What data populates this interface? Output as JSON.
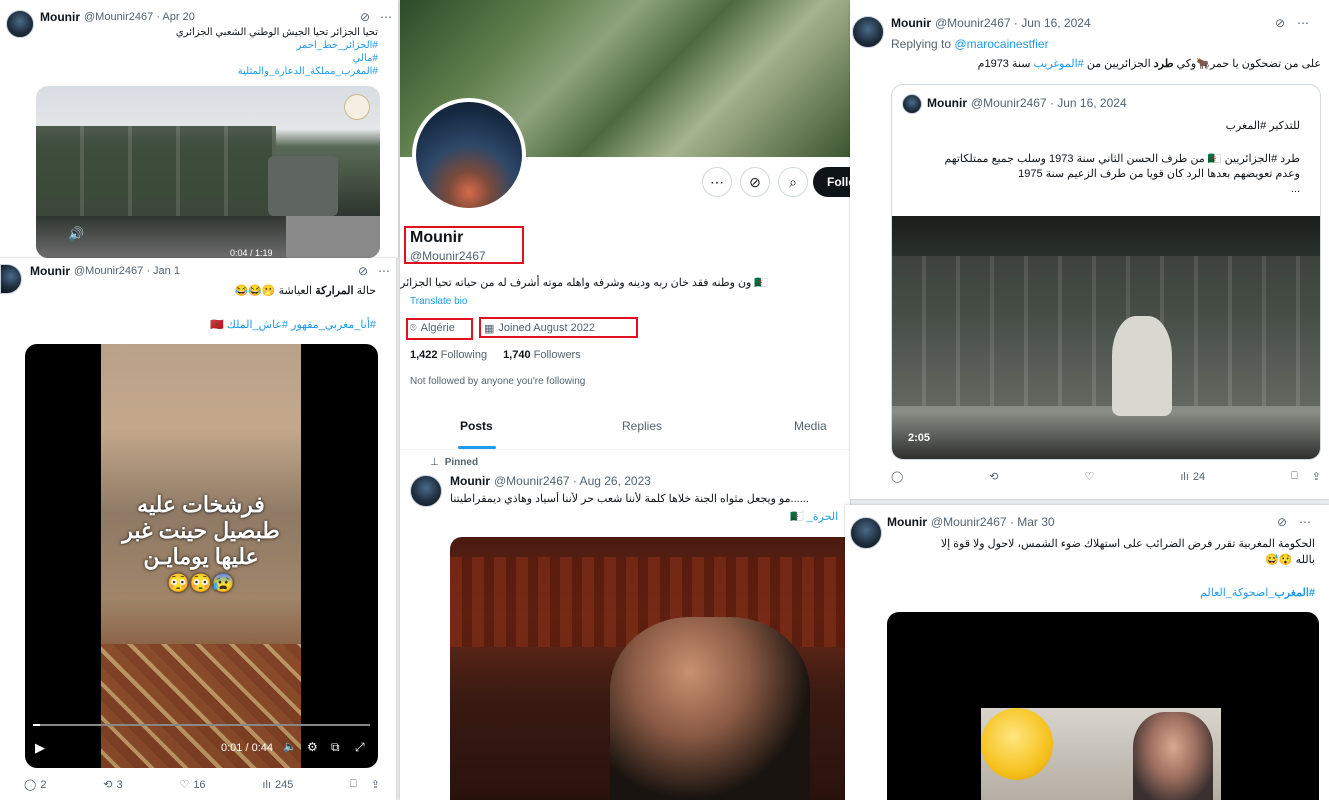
{
  "icons": {
    "more": "⋯",
    "grok": "⊘",
    "reply": "◯",
    "retweet": "⟲",
    "like": "♡",
    "views": "📊",
    "bookmark": "🔖",
    "share": "⤴",
    "location": "📍",
    "calendar": "📅",
    "pin": "📌",
    "search": "🔍",
    "play": "▶"
  },
  "top_left_tweet": {
    "name": "Mounir",
    "handle": "@Mounir2467 · Apr 20",
    "line1": "تحيا الجزائر تحيا الجيش الوطني الشعبي الجزائري",
    "line2": "#الجزائر_خط_احمر",
    "line3": "#مالي",
    "line4": "#المغرب_مملكة_الدعارة_والمثلية",
    "video_time": "0:04 / 1:19"
  },
  "mid_left_tweet": {
    "name": "Mounir",
    "handle": "@Mounir2467 · Jan 1",
    "line1_prefix": "حالة",
    "line1_bold": "المراركة",
    "line1_suffix": "العياشة 🫢😂😂",
    "line2": "#أنا_مغربي_مقهور #عاش_الملك 🇲🇦",
    "overlay_line1": "فرشخات عليه",
    "overlay_line2": "طبصيل حينت غبر",
    "overlay_line3": "عليها يومايـن",
    "overlay_emoji": "😰😳😳",
    "video_time": "0:01 / 0:44",
    "replies": "2",
    "retweets": "3",
    "likes": "16",
    "views": "245"
  },
  "profile": {
    "name": "Mounir",
    "handle": "@Mounir2467",
    "bio": "🇩🇿 ون وطنه فقد خان ربه ودينه وشرفه واهله موته أشرف له من حياته تحيا الجزائر",
    "translate": "Translate bio",
    "location": "Algérie",
    "joined": "Joined August 2022",
    "following_count": "1,422",
    "following_label": "Following",
    "followers_count": "1,740",
    "followers_label": "Followers",
    "not_followed": "Not followed by anyone you're following",
    "follow_button": "Follow",
    "tabs": [
      "Posts",
      "Replies",
      "Media"
    ]
  },
  "pinned_tweet": {
    "pinned_label": "Pinned",
    "name": "Mounir",
    "handle": "@Mounir2467 · Aug 26, 2023",
    "line1": "......مو ويجعل مثواه الجنة خلاها كلمة لأننا شعب حر لأننا أسياد وهاذي ديمقراطيتنا",
    "line2": "🇩🇿 _الحرة"
  },
  "top_right_tweet": {
    "name": "Mounir",
    "handle": "@Mounir2467 · Jun 16, 2024",
    "replying_prefix": "Replying to",
    "replying_to": "@marocainestfier",
    "text_a": "على من تضحكون يا حمر🐂وكي",
    "text_bold": "طرد",
    "text_b": "الجزائريين من",
    "text_link": "#الموغريب",
    "text_c": "سنة 1973م",
    "quote": {
      "name": "Mounir",
      "handle": "@Mounir2467 · Jun 16, 2024",
      "line1": "للتذكير #المغرب",
      "line2": "طرد #الجزائريين 🇩🇿 من طرف الحسن الثاني سنة 1973 وسلب جميع ممتلكاتهم",
      "line3": "وعدم تعويضهم بعدها الرد كان قويا من طرف الزعيم سنة 1975",
      "line4": "...",
      "video_time": "2:05"
    },
    "views": "24"
  },
  "bottom_right_tweet": {
    "name": "Mounir",
    "handle": "@Mounir2467 · Mar 30",
    "line1": "الحكومة المغربية تقرر فرض الضرائب على استهلاك ضوء الشمس، لاحول ولا قوة إلا",
    "line2": "بالله 😯😅",
    "line3_bold": "#المغرب",
    "line3_rest": "_اضحوكة_العالم"
  },
  "colors": {
    "accent": "#1d9bf0",
    "highlight_box": "#e0101e",
    "text": "#0f1419",
    "muted": "#536471"
  }
}
